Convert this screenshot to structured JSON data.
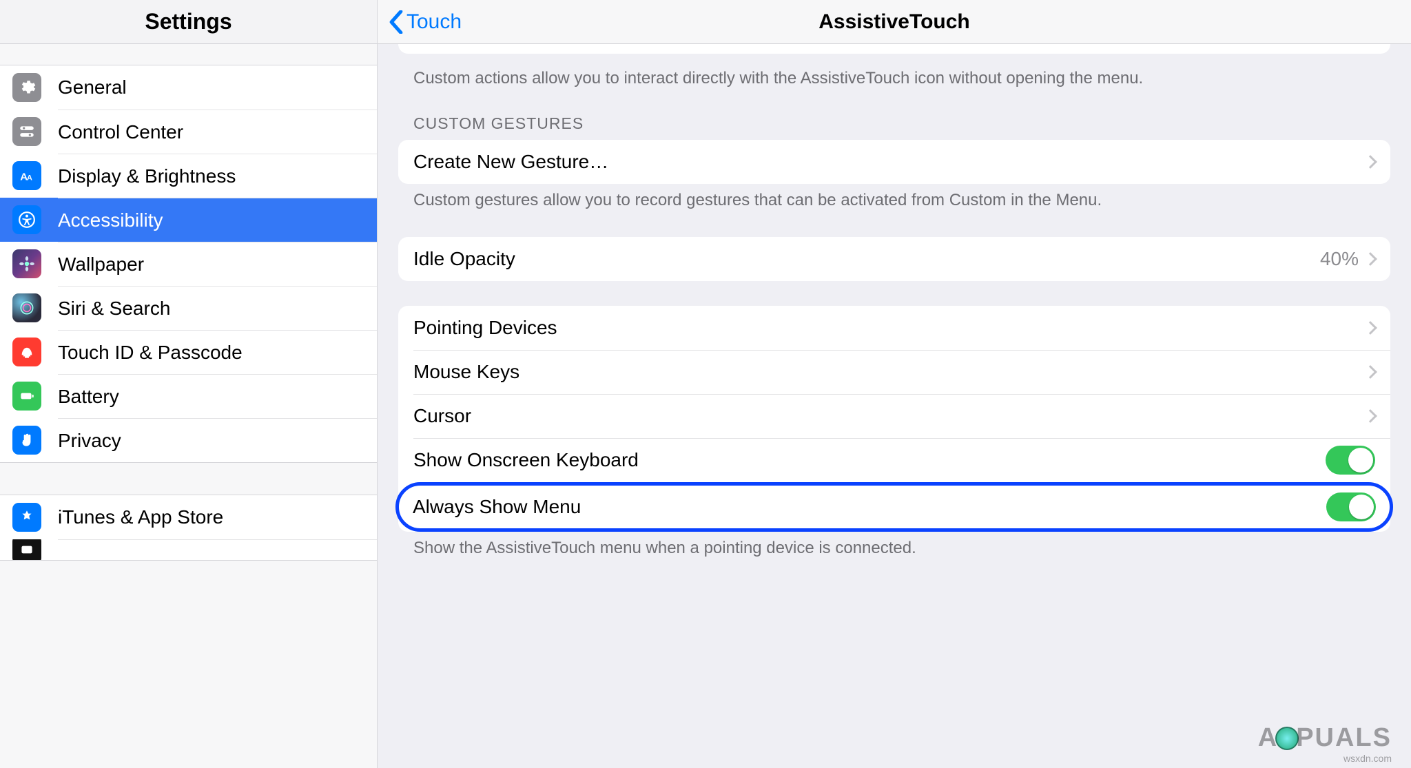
{
  "sidebar": {
    "title": "Settings",
    "group1": [
      {
        "label": "General",
        "icon": "gear-icon",
        "color": "gray"
      },
      {
        "label": "Control Center",
        "icon": "switches-icon",
        "color": "gray"
      },
      {
        "label": "Display & Brightness",
        "icon": "text-size-icon",
        "color": "blue"
      },
      {
        "label": "Accessibility",
        "icon": "accessibility-icon",
        "color": "blue",
        "selected": true
      },
      {
        "label": "Wallpaper",
        "icon": "flower-icon",
        "color": "multi"
      },
      {
        "label": "Siri & Search",
        "icon": "siri-icon",
        "color": "siri"
      },
      {
        "label": "Touch ID & Passcode",
        "icon": "fingerprint-icon",
        "color": "red"
      },
      {
        "label": "Battery",
        "icon": "battery-icon",
        "color": "green"
      },
      {
        "label": "Privacy",
        "icon": "hand-icon",
        "color": "blue"
      }
    ],
    "group2": [
      {
        "label": "iTunes & App Store",
        "icon": "appstore-icon",
        "color": "blue"
      },
      {
        "label": "",
        "icon": "wallet-icon",
        "color": "black-partial"
      }
    ]
  },
  "detail": {
    "back_label": "Touch",
    "title": "AssistiveTouch",
    "custom_actions_footer": "Custom actions allow you to interact directly with the AssistiveTouch icon without opening the menu.",
    "custom_gestures_header": "CUSTOM GESTURES",
    "create_gesture_label": "Create New Gesture…",
    "custom_gestures_footer": "Custom gestures allow you to record gestures that can be activated from Custom in the Menu.",
    "idle_opacity_label": "Idle Opacity",
    "idle_opacity_value": "40%",
    "pointing_devices_label": "Pointing Devices",
    "mouse_keys_label": "Mouse Keys",
    "cursor_label": "Cursor",
    "show_onscreen_keyboard_label": "Show Onscreen Keyboard",
    "show_onscreen_keyboard_on": true,
    "always_show_menu_label": "Always Show Menu",
    "always_show_menu_on": true,
    "always_show_menu_footer": "Show the AssistiveTouch menu when a pointing device is connected."
  },
  "watermark": {
    "logo_pre": "A",
    "logo_post": "PUALS",
    "site": "wsxdn.com"
  }
}
